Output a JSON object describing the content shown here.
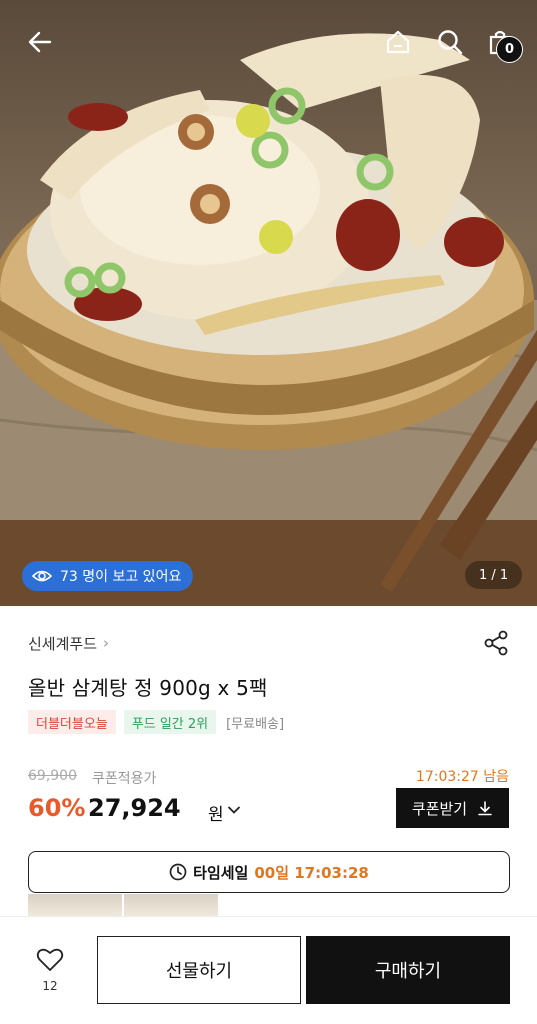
{
  "header": {
    "bag_count": "0"
  },
  "hero": {
    "viewers_text": "73 명이 보고 있어요",
    "pager_text": "1 / 1"
  },
  "product": {
    "brand": "신세계푸드",
    "title": "올반 삼계탕 정 900g x 5팩",
    "tags": [
      "더블더블오늘",
      "푸드 일간 2위",
      "[무료배송]"
    ],
    "original_price": "69,900",
    "coupon_note": "쿠폰적용가",
    "time_left": "17:03:27 남음",
    "discount": "60%",
    "price": "27,924",
    "currency": "원",
    "coupon_button": "쿠폰받기"
  },
  "timesale": {
    "label": "타임세일",
    "countdown": "00일 17:03:28"
  },
  "bottom_bar": {
    "like_count": "12",
    "gift_button": "선물하기",
    "buy_button": "구매하기"
  },
  "colors": {
    "accent_orange": "#e85a2a",
    "timer_orange": "#e0771f",
    "viewer_badge_blue": "#2c6fd6",
    "tag_red": "#d9483b",
    "tag_green": "#2e9e5b"
  }
}
